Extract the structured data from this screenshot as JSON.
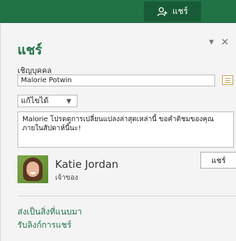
{
  "topbar": {
    "share_label": "แชร์"
  },
  "pane": {
    "title": "แชร์",
    "invite_label": "เชิญบุคคล",
    "invite_value": "Malorie Potwin",
    "permission": "แก้ไขได้",
    "message": "Malorie โปรดดูการเปลี่ยนแปลงล่าสุดเหล่านี้ ขอคำติชมของคุณภายในสัปดาห์นี้นะ!",
    "share_button": "แชร์",
    "owner": {
      "name": "Katie Jordan",
      "role": "เจ้าของ"
    },
    "links": [
      "ส่งเป็นสิ่งที่แนบมา",
      "รับลิงก์การแชร์"
    ]
  },
  "colors": {
    "accent": "#217346",
    "topbar": "#217346",
    "share_tab": "#185c37"
  }
}
